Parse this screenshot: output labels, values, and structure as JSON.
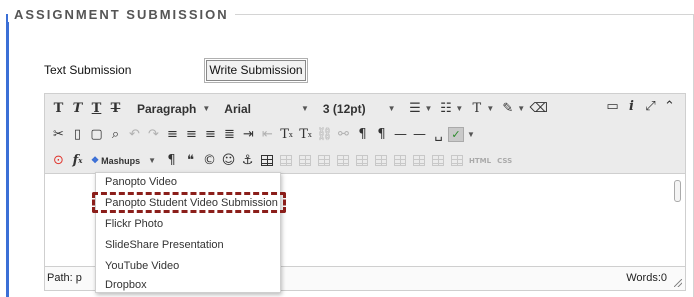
{
  "section": {
    "legend": "ASSIGNMENT SUBMISSION"
  },
  "text_submission": {
    "label": "Text Submission",
    "button": "Write Submission"
  },
  "toolbar": {
    "format_value": "Paragraph",
    "font_value": "Arial",
    "size_value": "3 (12pt)",
    "mashups_label": "Mashups",
    "html_label": "HTML",
    "css_label": "CSS"
  },
  "mashups_menu": {
    "items": [
      "Panopto Video",
      "Panopto Student Video Submission",
      "Flickr Photo",
      "SlideShare Presentation",
      "YouTube Video",
      "Dropbox"
    ],
    "highlighted_item": "Panopto Student Video Submission",
    "highlight_color": "#8b1e1a"
  },
  "status": {
    "path": "Path: p",
    "words": "Words:0"
  },
  "colors": {
    "frame_accent": "#3b6fd6",
    "toolbar_bg": "#ebebeb",
    "mashup_icon": "#e0342c"
  }
}
